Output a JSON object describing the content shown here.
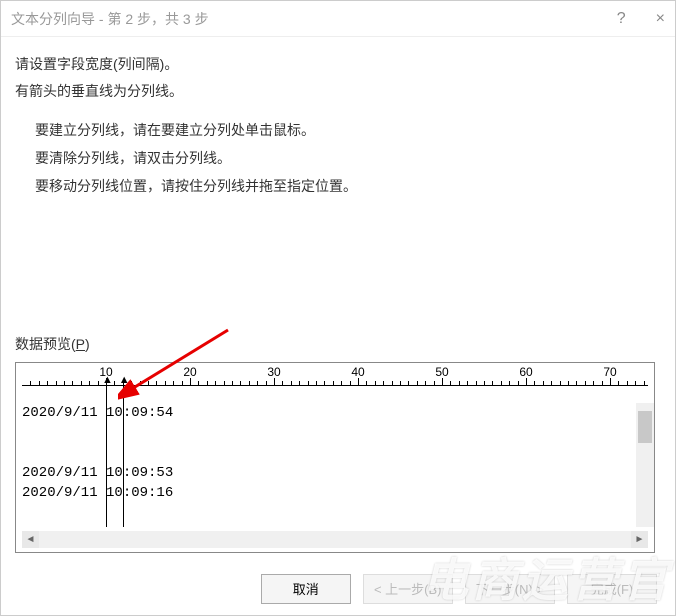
{
  "titlebar": {
    "title": "文本分列向导 - 第 2 步，共 3 步",
    "help": "?",
    "close": "×"
  },
  "instructions": {
    "line1": "请设置字段宽度(列间隔)。",
    "line2": "有箭头的垂直线为分列线。"
  },
  "sub_instructions": {
    "line1": "要建立分列线，请在要建立分列处单击鼠标。",
    "line2": "要清除分列线，请双击分列线。",
    "line3": "要移动分列线位置，请按住分列线并拖至指定位置。"
  },
  "preview": {
    "label_prefix": "数据预览(",
    "label_key": "P",
    "label_suffix": ")"
  },
  "ruler": {
    "majors": [
      10,
      20,
      30,
      40,
      50,
      60,
      70
    ]
  },
  "data_rows": [
    "2020/9/11 10:09:54",
    "",
    "",
    "2020/9/11 10:09:53",
    "2020/9/11 10:09:16"
  ],
  "breaks": [
    10,
    12
  ],
  "buttons": {
    "cancel": "取消",
    "back": "< 上一步(B)",
    "next": "下一步(N) >",
    "finish": "完成(F)"
  },
  "watermark": "电商运营官"
}
